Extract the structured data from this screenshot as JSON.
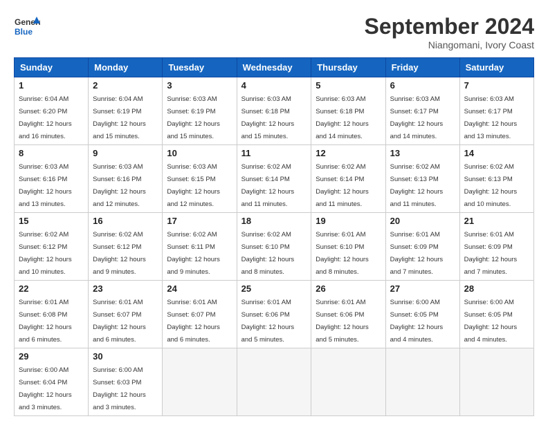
{
  "header": {
    "logo_line1": "General",
    "logo_line2": "Blue",
    "month_year": "September 2024",
    "location": "Niangomani, Ivory Coast"
  },
  "calendar": {
    "days_of_week": [
      "Sunday",
      "Monday",
      "Tuesday",
      "Wednesday",
      "Thursday",
      "Friday",
      "Saturday"
    ],
    "weeks": [
      [
        {
          "num": "",
          "detail": ""
        },
        {
          "num": "2",
          "detail": "Sunrise: 6:04 AM\nSunset: 6:19 PM\nDaylight: 12 hours\nand 15 minutes."
        },
        {
          "num": "3",
          "detail": "Sunrise: 6:03 AM\nSunset: 6:19 PM\nDaylight: 12 hours\nand 15 minutes."
        },
        {
          "num": "4",
          "detail": "Sunrise: 6:03 AM\nSunset: 6:18 PM\nDaylight: 12 hours\nand 15 minutes."
        },
        {
          "num": "5",
          "detail": "Sunrise: 6:03 AM\nSunset: 6:18 PM\nDaylight: 12 hours\nand 14 minutes."
        },
        {
          "num": "6",
          "detail": "Sunrise: 6:03 AM\nSunset: 6:17 PM\nDaylight: 12 hours\nand 14 minutes."
        },
        {
          "num": "7",
          "detail": "Sunrise: 6:03 AM\nSunset: 6:17 PM\nDaylight: 12 hours\nand 13 minutes."
        }
      ],
      [
        {
          "num": "8",
          "detail": "Sunrise: 6:03 AM\nSunset: 6:16 PM\nDaylight: 12 hours\nand 13 minutes."
        },
        {
          "num": "9",
          "detail": "Sunrise: 6:03 AM\nSunset: 6:16 PM\nDaylight: 12 hours\nand 12 minutes."
        },
        {
          "num": "10",
          "detail": "Sunrise: 6:03 AM\nSunset: 6:15 PM\nDaylight: 12 hours\nand 12 minutes."
        },
        {
          "num": "11",
          "detail": "Sunrise: 6:02 AM\nSunset: 6:14 PM\nDaylight: 12 hours\nand 11 minutes."
        },
        {
          "num": "12",
          "detail": "Sunrise: 6:02 AM\nSunset: 6:14 PM\nDaylight: 12 hours\nand 11 minutes."
        },
        {
          "num": "13",
          "detail": "Sunrise: 6:02 AM\nSunset: 6:13 PM\nDaylight: 12 hours\nand 11 minutes."
        },
        {
          "num": "14",
          "detail": "Sunrise: 6:02 AM\nSunset: 6:13 PM\nDaylight: 12 hours\nand 10 minutes."
        }
      ],
      [
        {
          "num": "15",
          "detail": "Sunrise: 6:02 AM\nSunset: 6:12 PM\nDaylight: 12 hours\nand 10 minutes."
        },
        {
          "num": "16",
          "detail": "Sunrise: 6:02 AM\nSunset: 6:12 PM\nDaylight: 12 hours\nand 9 minutes."
        },
        {
          "num": "17",
          "detail": "Sunrise: 6:02 AM\nSunset: 6:11 PM\nDaylight: 12 hours\nand 9 minutes."
        },
        {
          "num": "18",
          "detail": "Sunrise: 6:02 AM\nSunset: 6:10 PM\nDaylight: 12 hours\nand 8 minutes."
        },
        {
          "num": "19",
          "detail": "Sunrise: 6:01 AM\nSunset: 6:10 PM\nDaylight: 12 hours\nand 8 minutes."
        },
        {
          "num": "20",
          "detail": "Sunrise: 6:01 AM\nSunset: 6:09 PM\nDaylight: 12 hours\nand 7 minutes."
        },
        {
          "num": "21",
          "detail": "Sunrise: 6:01 AM\nSunset: 6:09 PM\nDaylight: 12 hours\nand 7 minutes."
        }
      ],
      [
        {
          "num": "22",
          "detail": "Sunrise: 6:01 AM\nSunset: 6:08 PM\nDaylight: 12 hours\nand 6 minutes."
        },
        {
          "num": "23",
          "detail": "Sunrise: 6:01 AM\nSunset: 6:07 PM\nDaylight: 12 hours\nand 6 minutes."
        },
        {
          "num": "24",
          "detail": "Sunrise: 6:01 AM\nSunset: 6:07 PM\nDaylight: 12 hours\nand 6 minutes."
        },
        {
          "num": "25",
          "detail": "Sunrise: 6:01 AM\nSunset: 6:06 PM\nDaylight: 12 hours\nand 5 minutes."
        },
        {
          "num": "26",
          "detail": "Sunrise: 6:01 AM\nSunset: 6:06 PM\nDaylight: 12 hours\nand 5 minutes."
        },
        {
          "num": "27",
          "detail": "Sunrise: 6:00 AM\nSunset: 6:05 PM\nDaylight: 12 hours\nand 4 minutes."
        },
        {
          "num": "28",
          "detail": "Sunrise: 6:00 AM\nSunset: 6:05 PM\nDaylight: 12 hours\nand 4 minutes."
        }
      ],
      [
        {
          "num": "29",
          "detail": "Sunrise: 6:00 AM\nSunset: 6:04 PM\nDaylight: 12 hours\nand 3 minutes."
        },
        {
          "num": "30",
          "detail": "Sunrise: 6:00 AM\nSunset: 6:03 PM\nDaylight: 12 hours\nand 3 minutes."
        },
        {
          "num": "",
          "detail": ""
        },
        {
          "num": "",
          "detail": ""
        },
        {
          "num": "",
          "detail": ""
        },
        {
          "num": "",
          "detail": ""
        },
        {
          "num": "",
          "detail": ""
        }
      ]
    ],
    "week0_sun": {
      "num": "1",
      "detail": "Sunrise: 6:04 AM\nSunset: 6:20 PM\nDaylight: 12 hours\nand 16 minutes."
    }
  }
}
